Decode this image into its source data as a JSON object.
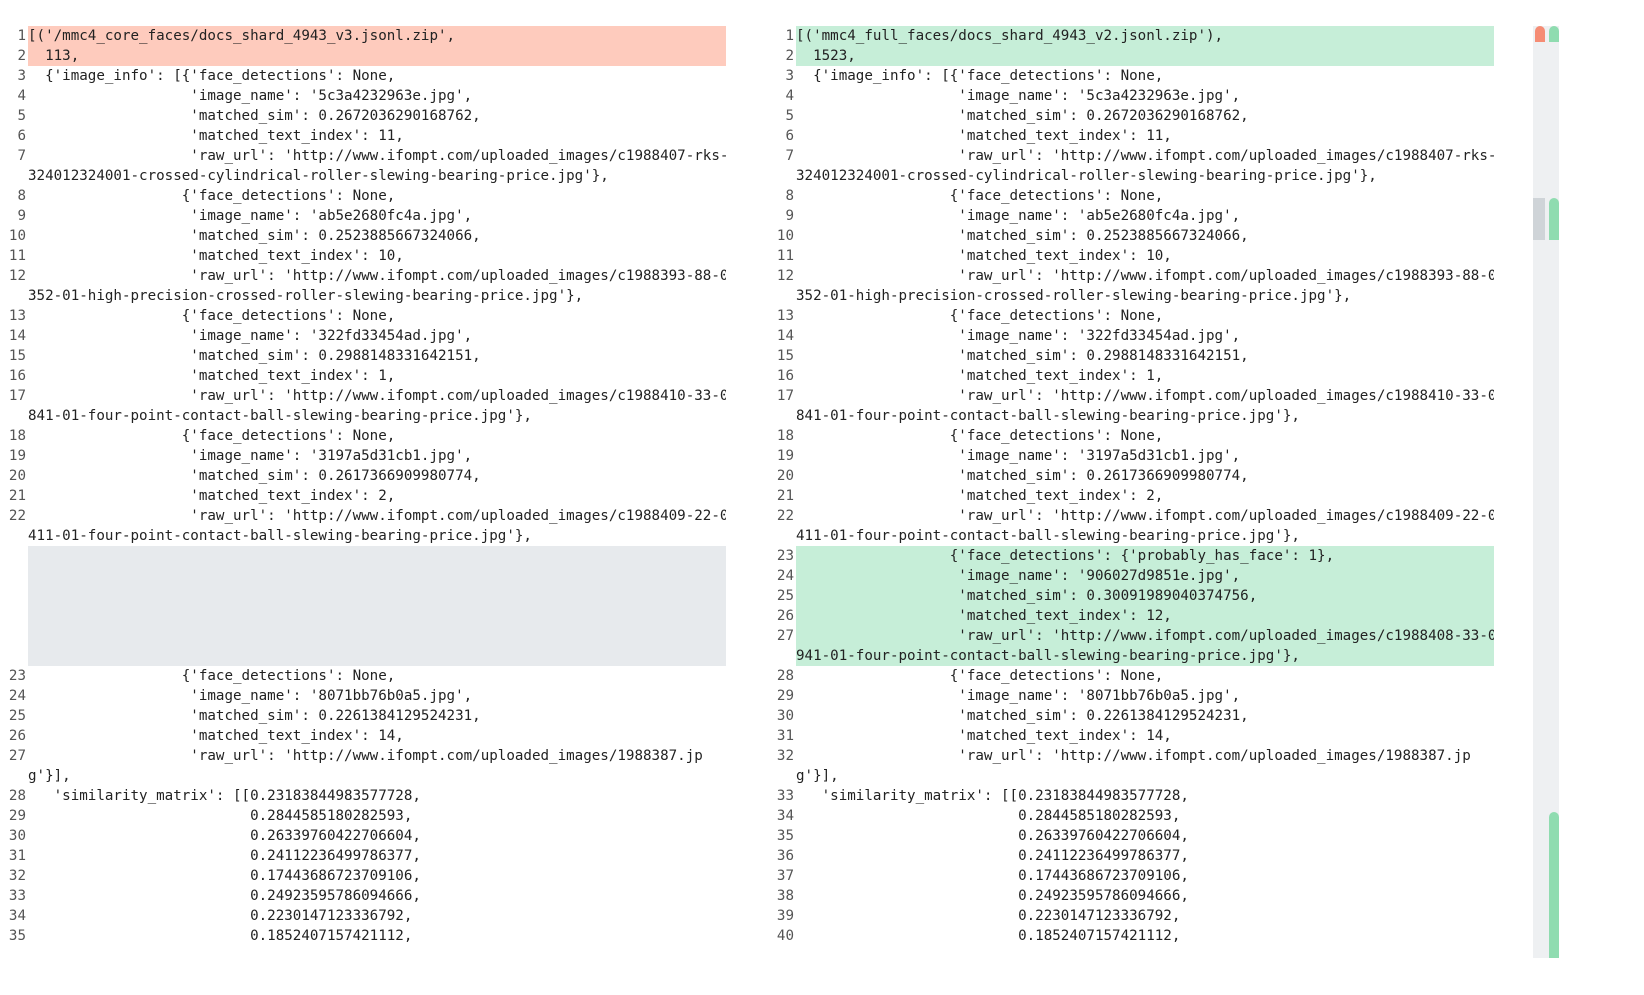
{
  "left": {
    "lines": [
      {
        "n": "1",
        "t": "[('/mmc4_core_faces/docs_shard_4943_v3.jsonl.zip',",
        "c": "del"
      },
      {
        "n": "2",
        "t": "  113,",
        "c": "del"
      },
      {
        "n": "3",
        "t": "  {'image_info': [{'face_detections': None,"
      },
      {
        "n": "4",
        "t": "                   'image_name': '5c3a4232963e.jpg',"
      },
      {
        "n": "5",
        "t": "                   'matched_sim': 0.2672036290168762,"
      },
      {
        "n": "6",
        "t": "                   'matched_text_index': 11,"
      },
      {
        "n": "7",
        "t": "                   'raw_url': 'http://www.ifompt.com/uploaded_images/c1988407-rks-"
      },
      {
        "n": "",
        "t": "324012324001-crossed-cylindrical-roller-slewing-bearing-price.jpg'},"
      },
      {
        "n": "8",
        "t": "                  {'face_detections': None,"
      },
      {
        "n": "9",
        "t": "                   'image_name': 'ab5e2680fc4a.jpg',"
      },
      {
        "n": "10",
        "t": "                   'matched_sim': 0.2523885667324066,"
      },
      {
        "n": "11",
        "t": "                   'matched_text_index': 10,"
      },
      {
        "n": "12",
        "t": "                   'raw_url': 'http://www.ifompt.com/uploaded_images/c1988393-88-0"
      },
      {
        "n": "",
        "t": "352-01-high-precision-crossed-roller-slewing-bearing-price.jpg'},"
      },
      {
        "n": "13",
        "t": "                  {'face_detections': None,"
      },
      {
        "n": "14",
        "t": "                   'image_name': '322fd33454ad.jpg',"
      },
      {
        "n": "15",
        "t": "                   'matched_sim': 0.2988148331642151,"
      },
      {
        "n": "16",
        "t": "                   'matched_text_index': 1,"
      },
      {
        "n": "17",
        "t": "                   'raw_url': 'http://www.ifompt.com/uploaded_images/c1988410-33-0"
      },
      {
        "n": "",
        "t": "841-01-four-point-contact-ball-slewing-bearing-price.jpg'},"
      },
      {
        "n": "18",
        "t": "                  {'face_detections': None,"
      },
      {
        "n": "19",
        "t": "                   'image_name': '3197a5d31cb1.jpg',"
      },
      {
        "n": "20",
        "t": "                   'matched_sim': 0.2617366909980774,"
      },
      {
        "n": "21",
        "t": "                   'matched_text_index': 2,"
      },
      {
        "n": "22",
        "t": "                   'raw_url': 'http://www.ifompt.com/uploaded_images/c1988409-22-0"
      },
      {
        "n": "",
        "t": "411-01-four-point-contact-ball-slewing-bearing-price.jpg'},"
      }
    ],
    "lines_after": [
      {
        "n": "23",
        "t": "                  {'face_detections': None,"
      },
      {
        "n": "24",
        "t": "                   'image_name': '8071bb76b0a5.jpg',"
      },
      {
        "n": "25",
        "t": "                   'matched_sim': 0.2261384129524231,"
      },
      {
        "n": "26",
        "t": "                   'matched_text_index': 14,"
      },
      {
        "n": "27",
        "t": "                   'raw_url': 'http://www.ifompt.com/uploaded_images/1988387.jp"
      },
      {
        "n": "",
        "t": "g'}],"
      },
      {
        "n": "28",
        "t": "   'similarity_matrix': [[0.23183844983577728,"
      },
      {
        "n": "29",
        "t": "                          0.2844585180282593,"
      },
      {
        "n": "30",
        "t": "                          0.26339760422706604,"
      },
      {
        "n": "31",
        "t": "                          0.24112236499786377,"
      },
      {
        "n": "32",
        "t": "                          0.17443686723709106,"
      },
      {
        "n": "33",
        "t": "                          0.24923595786094666,"
      },
      {
        "n": "34",
        "t": "                          0.2230147123336792,"
      },
      {
        "n": "35",
        "t": "                          0.1852407157421112,"
      }
    ]
  },
  "right": {
    "lines": [
      {
        "n": "1",
        "t": "[('mmc4_full_faces/docs_shard_4943_v2.jsonl.zip'),",
        "c": "ins"
      },
      {
        "n": "2",
        "t": "  1523,",
        "c": "ins"
      },
      {
        "n": "3",
        "t": "  {'image_info': [{'face_detections': None,"
      },
      {
        "n": "4",
        "t": "                   'image_name': '5c3a4232963e.jpg',"
      },
      {
        "n": "5",
        "t": "                   'matched_sim': 0.2672036290168762,"
      },
      {
        "n": "6",
        "t": "                   'matched_text_index': 11,"
      },
      {
        "n": "7",
        "t": "                   'raw_url': 'http://www.ifompt.com/uploaded_images/c1988407-rks-"
      },
      {
        "n": "",
        "t": "324012324001-crossed-cylindrical-roller-slewing-bearing-price.jpg'},"
      },
      {
        "n": "8",
        "t": "                  {'face_detections': None,"
      },
      {
        "n": "9",
        "t": "                   'image_name': 'ab5e2680fc4a.jpg',"
      },
      {
        "n": "10",
        "t": "                   'matched_sim': 0.2523885667324066,"
      },
      {
        "n": "11",
        "t": "                   'matched_text_index': 10,"
      },
      {
        "n": "12",
        "t": "                   'raw_url': 'http://www.ifompt.com/uploaded_images/c1988393-88-0"
      },
      {
        "n": "",
        "t": "352-01-high-precision-crossed-roller-slewing-bearing-price.jpg'},"
      },
      {
        "n": "13",
        "t": "                  {'face_detections': None,"
      },
      {
        "n": "14",
        "t": "                   'image_name': '322fd33454ad.jpg',"
      },
      {
        "n": "15",
        "t": "                   'matched_sim': 0.2988148331642151,"
      },
      {
        "n": "16",
        "t": "                   'matched_text_index': 1,"
      },
      {
        "n": "17",
        "t": "                   'raw_url': 'http://www.ifompt.com/uploaded_images/c1988410-33-0"
      },
      {
        "n": "",
        "t": "841-01-four-point-contact-ball-slewing-bearing-price.jpg'},"
      },
      {
        "n": "18",
        "t": "                  {'face_detections': None,"
      },
      {
        "n": "19",
        "t": "                   'image_name': '3197a5d31cb1.jpg',"
      },
      {
        "n": "20",
        "t": "                   'matched_sim': 0.2617366909980774,"
      },
      {
        "n": "21",
        "t": "                   'matched_text_index': 2,"
      },
      {
        "n": "22",
        "t": "                   'raw_url': 'http://www.ifompt.com/uploaded_images/c1988409-22-0"
      },
      {
        "n": "",
        "t": "411-01-four-point-contact-ball-slewing-bearing-price.jpg'},"
      },
      {
        "n": "23",
        "t": "                  {'face_detections': {'probably_has_face': 1},",
        "c": "ins"
      },
      {
        "n": "24",
        "t": "                   'image_name': '906027d9851e.jpg',",
        "c": "ins"
      },
      {
        "n": "25",
        "t": "                   'matched_sim': 0.30091989040374756,",
        "c": "ins"
      },
      {
        "n": "26",
        "t": "                   'matched_text_index': 12,",
        "c": "ins"
      },
      {
        "n": "27",
        "t": "                   'raw_url': 'http://www.ifompt.com/uploaded_images/c1988408-33-0",
        "c": "ins"
      },
      {
        "n": "",
        "t": "941-01-four-point-contact-ball-slewing-bearing-price.jpg'},",
        "c": "ins"
      },
      {
        "n": "28",
        "t": "                  {'face_detections': None,"
      },
      {
        "n": "29",
        "t": "                   'image_name': '8071bb76b0a5.jpg',"
      },
      {
        "n": "30",
        "t": "                   'matched_sim': 0.2261384129524231,"
      },
      {
        "n": "31",
        "t": "                   'matched_text_index': 14,"
      },
      {
        "n": "32",
        "t": "                   'raw_url': 'http://www.ifompt.com/uploaded_images/1988387.jp"
      },
      {
        "n": "",
        "t": "g'}],"
      },
      {
        "n": "33",
        "t": "   'similarity_matrix': [[0.23183844983577728,"
      },
      {
        "n": "34",
        "t": "                          0.2844585180282593,"
      },
      {
        "n": "35",
        "t": "                          0.26339760422706604,"
      },
      {
        "n": "36",
        "t": "                          0.24112236499786377,"
      },
      {
        "n": "37",
        "t": "                          0.17443686723709106,"
      },
      {
        "n": "38",
        "t": "                          0.24923595786094666,"
      },
      {
        "n": "39",
        "t": "                          0.2230147123336792,"
      },
      {
        "n": "40",
        "t": "                          0.1852407157421112,"
      }
    ]
  },
  "colors": {
    "deleted_line": "#fecbbd",
    "inserted_line": "#c6eed8",
    "placeholder": "#e7eaed"
  }
}
